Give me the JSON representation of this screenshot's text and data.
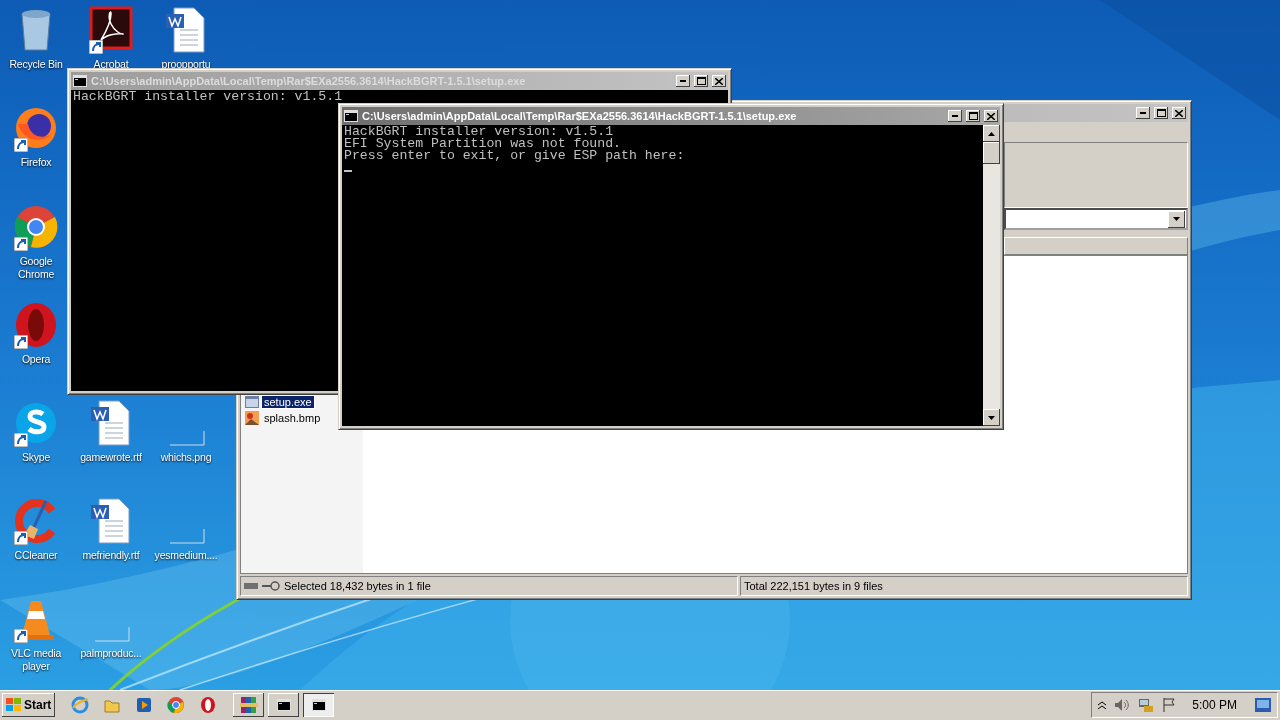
{
  "desktop_icons": [
    {
      "label": "Recycle Bin",
      "kind": "recycle"
    },
    {
      "label": "Acrobat",
      "kind": "acrobat"
    },
    {
      "label": "proopportu",
      "kind": "word"
    },
    {
      "label": "Firefox",
      "kind": "firefox"
    },
    {
      "label": "Google Chrome",
      "kind": "chrome"
    },
    {
      "label": "Opera",
      "kind": "opera"
    },
    {
      "label": "Skype",
      "kind": "skype"
    },
    {
      "label": "gamewrote.rtf",
      "kind": "word"
    },
    {
      "label": "whichs.png",
      "kind": "blank"
    },
    {
      "label": "CCleaner",
      "kind": "ccleaner"
    },
    {
      "label": "mefriendly.rtf",
      "kind": "word"
    },
    {
      "label": "yesmedium....",
      "kind": "blank"
    },
    {
      "label": "VLC media player",
      "kind": "vlc"
    },
    {
      "label": "palmproduc...",
      "kind": "blank"
    }
  ],
  "winrar": {
    "files": [
      {
        "name": "setup.exe",
        "selected": true,
        "kind": "exe"
      },
      {
        "name": "splash.bmp",
        "selected": false,
        "kind": "bmp"
      }
    ],
    "status_left": "Selected 18,432 bytes in 1 file",
    "status_right": "Total 222,151 bytes in 9 files"
  },
  "consoles": [
    {
      "title": "C:\\Users\\admin\\AppData\\Local\\Temp\\Rar$EXa2556.3614\\HackBGRT-1.5.1\\setup.exe",
      "lines": [
        "HackBGRT installer version: v1.5.1"
      ],
      "active": false,
      "cursor": false
    },
    {
      "title": "C:\\Users\\admin\\AppData\\Local\\Temp\\Rar$EXa2556.3614\\HackBGRT-1.5.1\\setup.exe",
      "lines": [
        "HackBGRT installer version: v1.5.1",
        "EFI System Partition was not found.",
        "Press enter to exit, or give ESP path here:"
      ],
      "active": true,
      "cursor": true
    }
  ],
  "taskbar": {
    "start": "Start",
    "quick_launch": [
      {
        "kind": "ie"
      },
      {
        "kind": "folder"
      },
      {
        "kind": "media"
      },
      {
        "kind": "chrome"
      },
      {
        "kind": "opera"
      }
    ],
    "tasks": [
      {
        "kind": "winrar",
        "selected": false
      },
      {
        "kind": "console",
        "selected": false
      },
      {
        "kind": "console",
        "selected": true
      }
    ],
    "clock": "5:00 PM"
  }
}
